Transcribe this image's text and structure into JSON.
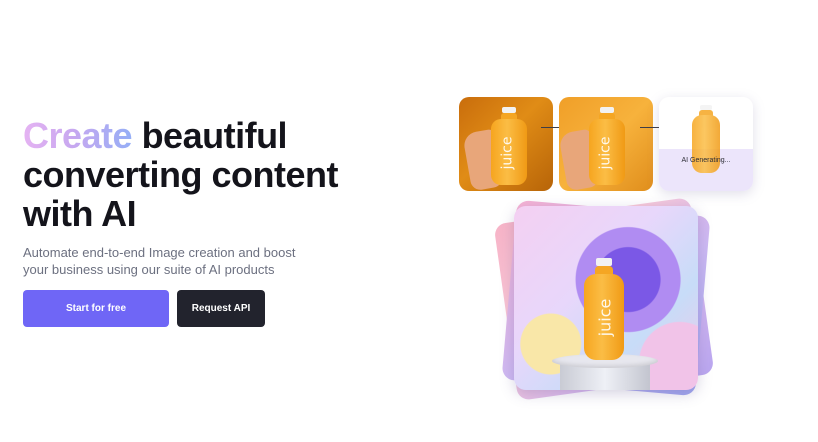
{
  "hero": {
    "headline_highlight": "Create",
    "headline_line1_rest": " beautiful",
    "headline_line2": "converting content",
    "headline_line3": "with AI",
    "subtitle": "Automate end-to-end Image creation and boost your business using our suite of AI products"
  },
  "cta": {
    "primary_label": "Start for free",
    "secondary_label": "Request API"
  },
  "pipeline": {
    "generating_label": "AI Generating...",
    "bottle_brand": "juice"
  },
  "colors": {
    "primary_button": "#6f66f6",
    "dark_button": "#22232d",
    "headline_text": "#14141b",
    "subtitle_text": "#6c7080"
  }
}
